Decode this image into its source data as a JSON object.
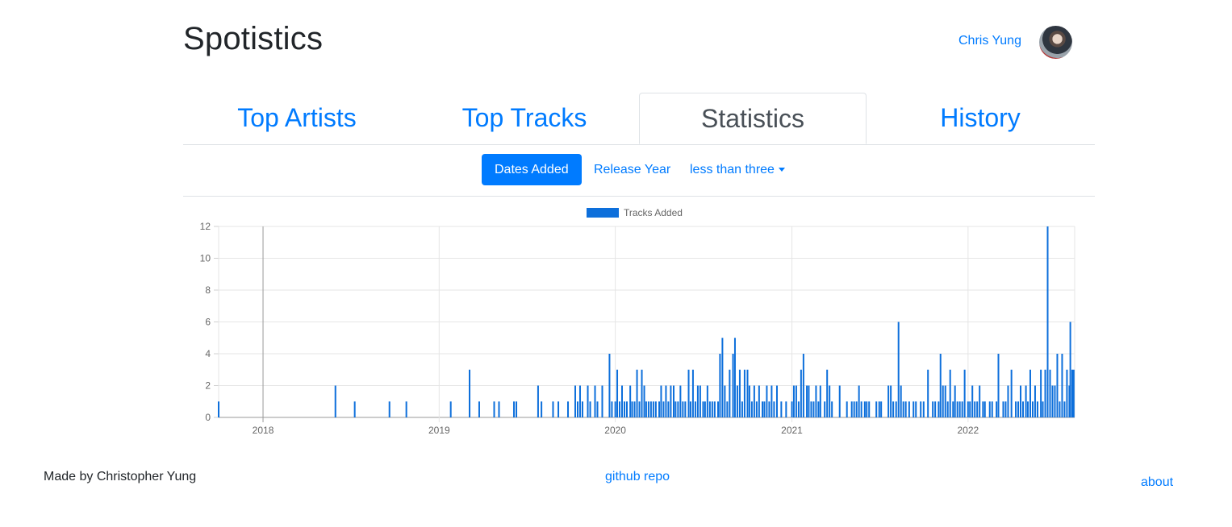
{
  "header": {
    "brand": "Spotistics",
    "user_name": "Chris Yung"
  },
  "tabs": [
    {
      "label": "Top Artists",
      "active": false
    },
    {
      "label": "Top Tracks",
      "active": false
    },
    {
      "label": "Statistics",
      "active": true
    },
    {
      "label": "History",
      "active": false
    }
  ],
  "subnav": {
    "dates_added": "Dates Added",
    "release_year": "Release Year",
    "dropdown": "less than three"
  },
  "chart_data": {
    "type": "bar",
    "legend": [
      {
        "name": "Tracks Added",
        "color": "#0d6fdb"
      }
    ],
    "legend_position": "top",
    "y_ticks": [
      0,
      2,
      4,
      6,
      8,
      10,
      12
    ],
    "ylim": [
      0,
      12
    ],
    "x_ticks": [
      "2018",
      "2019",
      "2020",
      "2021",
      "2022"
    ],
    "xlim": [
      "2017-10-01",
      "2022-08-10"
    ],
    "grid": true,
    "series": [
      {
        "name": "Tracks Added",
        "points": [
          [
            "2017-10-01",
            1
          ],
          [
            "2018-05-31",
            2
          ],
          [
            "2018-07-10",
            1
          ],
          [
            "2018-09-20",
            1
          ],
          [
            "2018-10-25",
            1
          ],
          [
            "2019-01-25",
            1
          ],
          [
            "2019-03-05",
            3
          ],
          [
            "2019-03-25",
            1
          ],
          [
            "2019-04-25",
            1
          ],
          [
            "2019-05-05",
            1
          ],
          [
            "2019-06-05",
            1
          ],
          [
            "2019-06-10",
            1
          ],
          [
            "2019-07-25",
            2
          ],
          [
            "2019-08-01",
            1
          ],
          [
            "2019-08-25",
            1
          ],
          [
            "2019-09-05",
            1
          ],
          [
            "2019-09-25",
            1
          ],
          [
            "2019-10-10",
            2
          ],
          [
            "2019-10-15",
            1
          ],
          [
            "2019-10-20",
            2
          ],
          [
            "2019-10-25",
            1
          ],
          [
            "2019-11-05",
            2
          ],
          [
            "2019-11-10",
            1
          ],
          [
            "2019-11-20",
            2
          ],
          [
            "2019-11-25",
            1
          ],
          [
            "2019-12-05",
            2
          ],
          [
            "2019-12-20",
            4
          ],
          [
            "2019-12-25",
            1
          ],
          [
            "2020-01-01",
            1
          ],
          [
            "2020-01-05",
            3
          ],
          [
            "2020-01-10",
            1
          ],
          [
            "2020-01-15",
            2
          ],
          [
            "2020-01-20",
            1
          ],
          [
            "2020-01-25",
            1
          ],
          [
            "2020-02-01",
            2
          ],
          [
            "2020-02-05",
            1
          ],
          [
            "2020-02-10",
            1
          ],
          [
            "2020-02-15",
            3
          ],
          [
            "2020-02-20",
            1
          ],
          [
            "2020-02-25",
            3
          ],
          [
            "2020-03-01",
            2
          ],
          [
            "2020-03-05",
            1
          ],
          [
            "2020-03-10",
            1
          ],
          [
            "2020-03-15",
            1
          ],
          [
            "2020-03-20",
            1
          ],
          [
            "2020-03-25",
            1
          ],
          [
            "2020-04-01",
            1
          ],
          [
            "2020-04-05",
            2
          ],
          [
            "2020-04-10",
            1
          ],
          [
            "2020-04-15",
            2
          ],
          [
            "2020-04-20",
            1
          ],
          [
            "2020-04-25",
            2
          ],
          [
            "2020-05-01",
            2
          ],
          [
            "2020-05-05",
            1
          ],
          [
            "2020-05-10",
            1
          ],
          [
            "2020-05-15",
            2
          ],
          [
            "2020-05-20",
            1
          ],
          [
            "2020-05-25",
            1
          ],
          [
            "2020-06-01",
            3
          ],
          [
            "2020-06-05",
            1
          ],
          [
            "2020-06-10",
            3
          ],
          [
            "2020-06-15",
            1
          ],
          [
            "2020-06-20",
            2
          ],
          [
            "2020-06-25",
            2
          ],
          [
            "2020-07-01",
            1
          ],
          [
            "2020-07-05",
            1
          ],
          [
            "2020-07-10",
            2
          ],
          [
            "2020-07-15",
            1
          ],
          [
            "2020-07-20",
            1
          ],
          [
            "2020-07-25",
            1
          ],
          [
            "2020-08-01",
            1
          ],
          [
            "2020-08-05",
            4
          ],
          [
            "2020-08-10",
            5
          ],
          [
            "2020-08-15",
            2
          ],
          [
            "2020-08-20",
            1
          ],
          [
            "2020-08-25",
            3
          ],
          [
            "2020-09-01",
            4
          ],
          [
            "2020-09-05",
            5
          ],
          [
            "2020-09-10",
            2
          ],
          [
            "2020-09-15",
            3
          ],
          [
            "2020-09-20",
            1
          ],
          [
            "2020-09-25",
            3
          ],
          [
            "2020-10-01",
            3
          ],
          [
            "2020-10-05",
            2
          ],
          [
            "2020-10-10",
            1
          ],
          [
            "2020-10-15",
            2
          ],
          [
            "2020-10-20",
            1
          ],
          [
            "2020-10-25",
            2
          ],
          [
            "2020-11-01",
            1
          ],
          [
            "2020-11-05",
            1
          ],
          [
            "2020-11-10",
            2
          ],
          [
            "2020-11-15",
            1
          ],
          [
            "2020-11-20",
            2
          ],
          [
            "2020-11-25",
            1
          ],
          [
            "2020-12-01",
            2
          ],
          [
            "2020-12-10",
            1
          ],
          [
            "2020-12-20",
            1
          ],
          [
            "2021-01-01",
            1
          ],
          [
            "2021-01-05",
            2
          ],
          [
            "2021-01-10",
            2
          ],
          [
            "2021-01-15",
            1
          ],
          [
            "2021-01-20",
            3
          ],
          [
            "2021-01-25",
            4
          ],
          [
            "2021-02-01",
            2
          ],
          [
            "2021-02-05",
            2
          ],
          [
            "2021-02-10",
            1
          ],
          [
            "2021-02-15",
            1
          ],
          [
            "2021-02-20",
            2
          ],
          [
            "2021-02-25",
            1
          ],
          [
            "2021-03-01",
            2
          ],
          [
            "2021-03-10",
            1
          ],
          [
            "2021-03-15",
            3
          ],
          [
            "2021-03-20",
            2
          ],
          [
            "2021-03-25",
            1
          ],
          [
            "2021-04-10",
            2
          ],
          [
            "2021-04-25",
            1
          ],
          [
            "2021-05-05",
            1
          ],
          [
            "2021-05-10",
            1
          ],
          [
            "2021-05-15",
            1
          ],
          [
            "2021-05-20",
            2
          ],
          [
            "2021-05-25",
            1
          ],
          [
            "2021-06-01",
            1
          ],
          [
            "2021-06-05",
            1
          ],
          [
            "2021-06-10",
            1
          ],
          [
            "2021-06-25",
            1
          ],
          [
            "2021-07-01",
            1
          ],
          [
            "2021-07-05",
            1
          ],
          [
            "2021-07-20",
            2
          ],
          [
            "2021-07-25",
            2
          ],
          [
            "2021-07-30",
            1
          ],
          [
            "2021-08-05",
            1
          ],
          [
            "2021-08-10",
            6
          ],
          [
            "2021-08-15",
            2
          ],
          [
            "2021-08-20",
            1
          ],
          [
            "2021-08-25",
            1
          ],
          [
            "2021-09-01",
            1
          ],
          [
            "2021-09-10",
            1
          ],
          [
            "2021-09-15",
            1
          ],
          [
            "2021-09-25",
            1
          ],
          [
            "2021-10-01",
            1
          ],
          [
            "2021-10-10",
            3
          ],
          [
            "2021-10-20",
            1
          ],
          [
            "2021-10-25",
            1
          ],
          [
            "2021-11-01",
            1
          ],
          [
            "2021-11-05",
            4
          ],
          [
            "2021-11-10",
            2
          ],
          [
            "2021-11-15",
            2
          ],
          [
            "2021-11-20",
            1
          ],
          [
            "2021-11-25",
            3
          ],
          [
            "2021-12-01",
            1
          ],
          [
            "2021-12-05",
            2
          ],
          [
            "2021-12-10",
            1
          ],
          [
            "2021-12-15",
            1
          ],
          [
            "2021-12-20",
            1
          ],
          [
            "2021-12-25",
            3
          ],
          [
            "2022-01-01",
            1
          ],
          [
            "2022-01-05",
            1
          ],
          [
            "2022-01-10",
            2
          ],
          [
            "2022-01-15",
            1
          ],
          [
            "2022-01-20",
            1
          ],
          [
            "2022-01-25",
            2
          ],
          [
            "2022-02-01",
            1
          ],
          [
            "2022-02-05",
            1
          ],
          [
            "2022-02-15",
            1
          ],
          [
            "2022-02-20",
            1
          ],
          [
            "2022-03-01",
            1
          ],
          [
            "2022-03-05",
            4
          ],
          [
            "2022-03-15",
            1
          ],
          [
            "2022-03-20",
            1
          ],
          [
            "2022-03-25",
            2
          ],
          [
            "2022-04-01",
            3
          ],
          [
            "2022-04-10",
            1
          ],
          [
            "2022-04-15",
            1
          ],
          [
            "2022-04-20",
            2
          ],
          [
            "2022-04-25",
            1
          ],
          [
            "2022-05-01",
            2
          ],
          [
            "2022-05-05",
            1
          ],
          [
            "2022-05-10",
            3
          ],
          [
            "2022-05-15",
            1
          ],
          [
            "2022-05-20",
            2
          ],
          [
            "2022-05-25",
            1
          ],
          [
            "2022-06-01",
            3
          ],
          [
            "2022-06-05",
            1
          ],
          [
            "2022-06-10",
            3
          ],
          [
            "2022-06-15",
            12
          ],
          [
            "2022-06-20",
            3
          ],
          [
            "2022-06-25",
            2
          ],
          [
            "2022-06-30",
            2
          ],
          [
            "2022-07-05",
            4
          ],
          [
            "2022-07-10",
            1
          ],
          [
            "2022-07-15",
            4
          ],
          [
            "2022-07-20",
            1
          ],
          [
            "2022-07-25",
            3
          ],
          [
            "2022-07-30",
            2
          ],
          [
            "2022-08-01",
            6
          ],
          [
            "2022-08-05",
            3
          ],
          [
            "2022-08-08",
            3
          ]
        ]
      }
    ]
  },
  "footer": {
    "made_by": "Made by Christopher Yung",
    "repo": "github repo",
    "about": "about"
  }
}
